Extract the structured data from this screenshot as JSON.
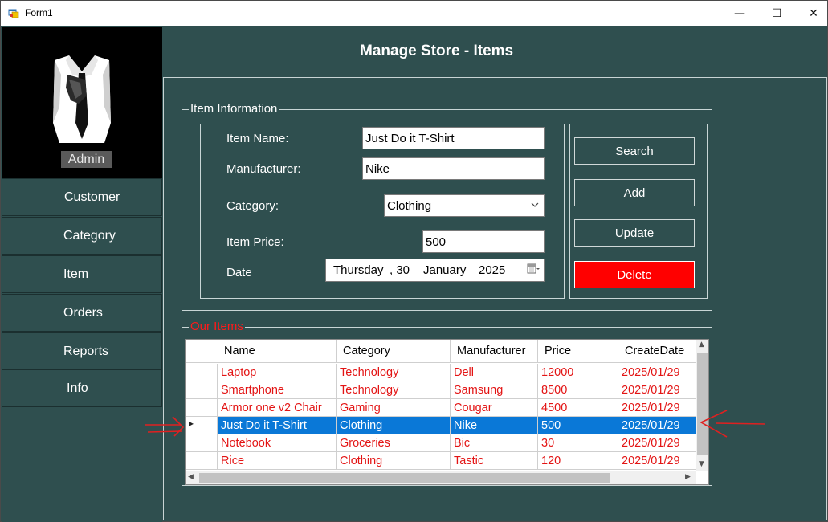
{
  "window": {
    "title": "Form1",
    "minimize_glyph": "—",
    "maximize_glyph": "☐",
    "close_glyph": "✕"
  },
  "sidebar": {
    "user_label": "Admin",
    "items": [
      {
        "label": "Customer"
      },
      {
        "label": "Category"
      },
      {
        "label": "Item"
      },
      {
        "label": "Orders"
      },
      {
        "label": "Reports"
      },
      {
        "label": "Info"
      }
    ]
  },
  "header": {
    "title": "Manage Store - Items"
  },
  "item_info": {
    "group_label": "Item Information",
    "item_name": {
      "label": "Item Name:",
      "value": "Just Do it T-Shirt"
    },
    "manufacturer": {
      "label": "Manufacturer:",
      "value": "Nike"
    },
    "category": {
      "label": "Category:",
      "value": "Clothing"
    },
    "price": {
      "label": "Item Price:",
      "value": "500"
    },
    "date": {
      "label": "Date",
      "day_name": "Thursday",
      "day": ", 30",
      "month": "January",
      "year": "2025"
    }
  },
  "actions": {
    "search": "Search",
    "add": "Add",
    "update": "Update",
    "delete": "Delete"
  },
  "items_grid": {
    "group_label": "Our Items",
    "columns": [
      "Name",
      "Category",
      "Manufacturer",
      "Price",
      "CreateDate"
    ],
    "rows": [
      [
        "Laptop",
        "Technology",
        "Dell",
        "12000",
        "2025/01/29"
      ],
      [
        "Smartphone",
        "Technology",
        "Samsung",
        "8500",
        "2025/01/29"
      ],
      [
        "Armor one v2 Chair",
        "Gaming",
        "Cougar",
        "4500",
        "2025/01/29"
      ],
      [
        "Just Do it T-Shirt",
        "Clothing",
        "Nike",
        "500",
        "2025/01/29"
      ],
      [
        "Notebook",
        "Groceries",
        "Bic",
        "30",
        "2025/01/29"
      ],
      [
        "Rice",
        "Clothing",
        "Tastic",
        "120",
        "2025/01/29"
      ]
    ],
    "selected_row": 3
  },
  "colors": {
    "background": "#2f4f4f",
    "accent_red": "#ff0000",
    "selection": "#0a78d7",
    "grid_text": "#e31414"
  }
}
